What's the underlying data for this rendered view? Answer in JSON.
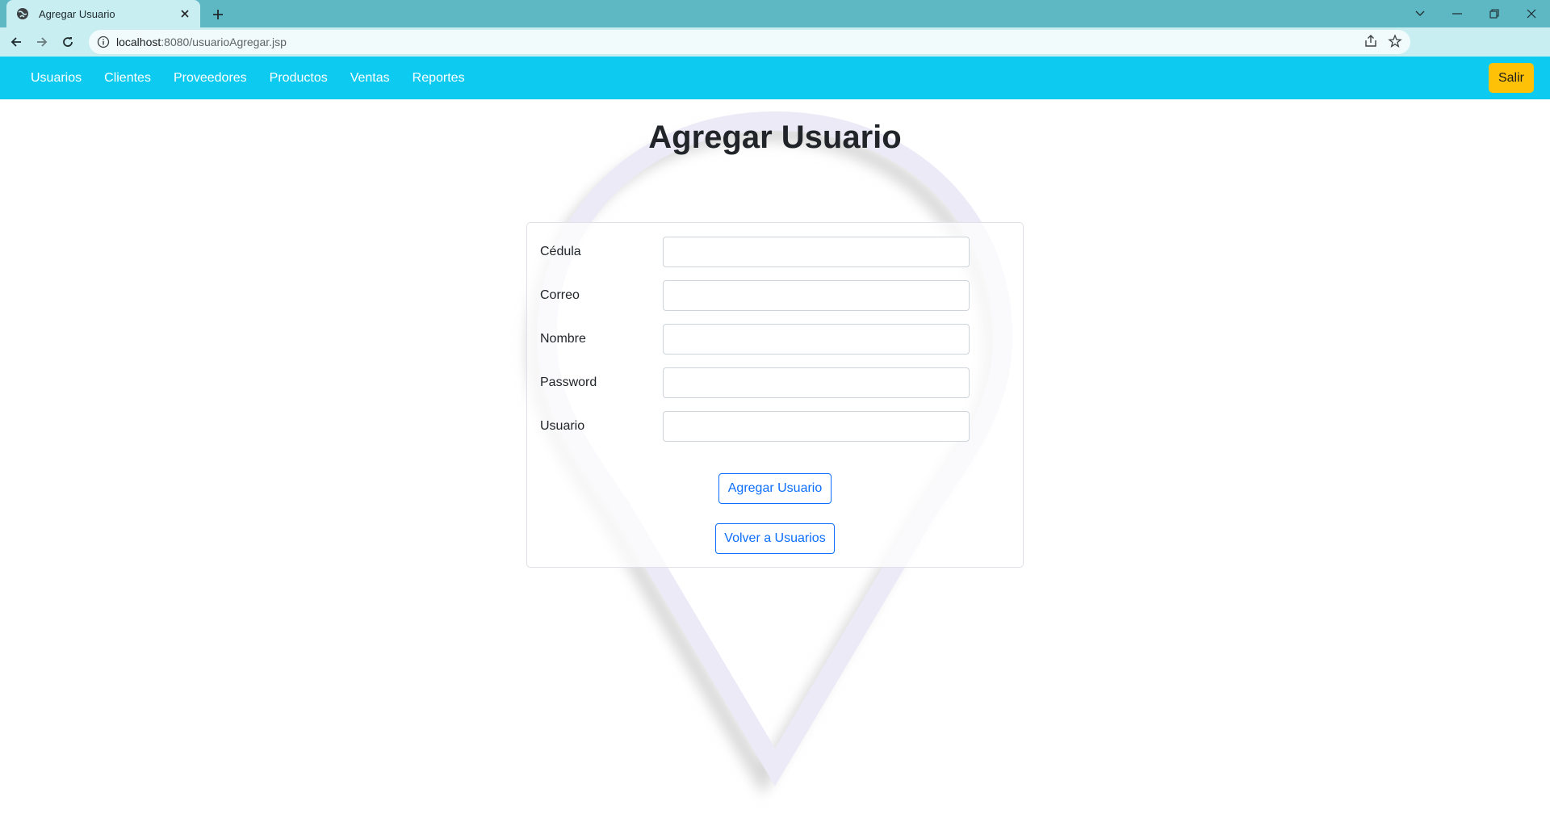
{
  "browser": {
    "tab_title": "Agregar Usuario",
    "url_host": "localhost",
    "url_rest": ":8080/usuarioAgregar.jsp"
  },
  "nav": {
    "links": [
      "Usuarios",
      "Clientes",
      "Proveedores",
      "Productos",
      "Ventas",
      "Reportes"
    ],
    "logout_label": "Salir"
  },
  "page": {
    "title": "Agregar Usuario"
  },
  "form": {
    "fields": [
      {
        "label": "Cédula",
        "value": ""
      },
      {
        "label": "Correo",
        "value": ""
      },
      {
        "label": "Nombre",
        "value": ""
      },
      {
        "label": "Password",
        "value": ""
      },
      {
        "label": "Usuario",
        "value": ""
      }
    ],
    "submit_label": "Agregar Usuario",
    "back_label": "Volver a Usuarios"
  },
  "colors": {
    "tabstrip": "#5db8c4",
    "navbar": "#0dcaf0",
    "logout": "#ffc107",
    "primary": "#0d6efd"
  },
  "icons": [
    "globe-icon",
    "close-icon",
    "plus-icon",
    "back-arrow-icon",
    "forward-arrow-icon",
    "reload-icon",
    "info-icon",
    "share-icon",
    "star-icon",
    "extension-icon",
    "profile-avatar-icon",
    "menu-dots-icon"
  ]
}
